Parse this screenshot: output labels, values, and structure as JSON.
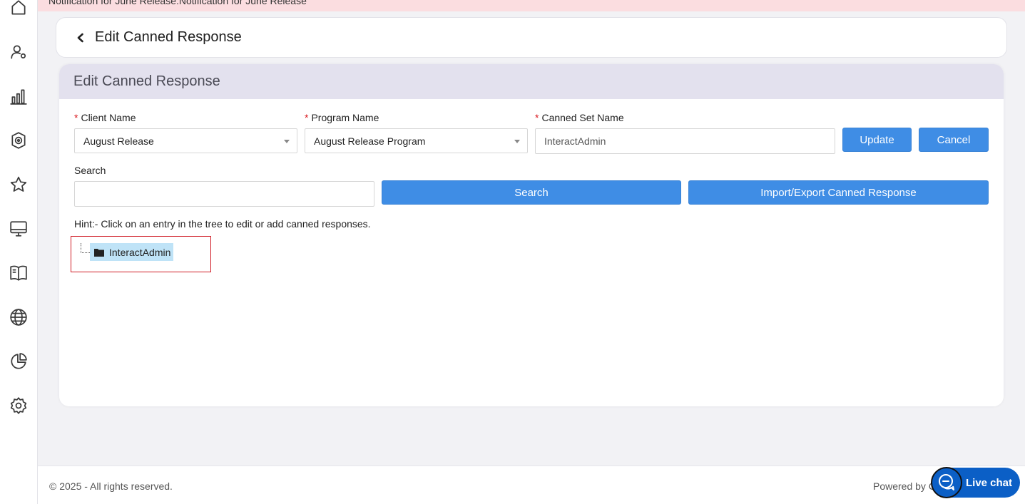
{
  "banner": {
    "text": "Notification for June Release:Notification for June Release"
  },
  "sidebar": {
    "items": [
      {
        "icon": "home-icon"
      },
      {
        "icon": "user-settings-icon"
      },
      {
        "icon": "bar-chart-icon"
      },
      {
        "icon": "target-icon"
      },
      {
        "icon": "star-icon"
      },
      {
        "icon": "monitor-icon"
      },
      {
        "icon": "book-icon"
      },
      {
        "icon": "globe-icon"
      },
      {
        "icon": "pie-chart-icon"
      },
      {
        "icon": "gear-icon"
      }
    ]
  },
  "header": {
    "title": "Edit Canned Response"
  },
  "card": {
    "title": "Edit Canned Response"
  },
  "form": {
    "required_mark": "*",
    "client_label": "Client Name",
    "client_value": "August Release",
    "program_label": "Program Name",
    "program_value": "August Release Program",
    "canned_set_label": "Canned Set Name",
    "canned_set_value": "InteractAdmin",
    "update_label": "Update",
    "cancel_label": "Cancel",
    "search_label": "Search",
    "search_value": "",
    "search_button": "Search",
    "import_export_button": "Import/Export Canned Response",
    "hint": "Hint:- Click on an entry in the tree to edit or add canned responses."
  },
  "tree": {
    "root_label": "InteractAdmin"
  },
  "footer": {
    "copyright": "© 2025 - All rights reserved.",
    "powered_by": "Powered by C"
  },
  "livechat": {
    "label": "Live chat"
  },
  "colors": {
    "primary": "#3f8de5",
    "banner": "#fbdde0",
    "card_header": "#e3e1ee",
    "tree_selected": "#bfe3f7",
    "highlight_border": "#d01c25",
    "livechat": "#0b5fc6"
  }
}
